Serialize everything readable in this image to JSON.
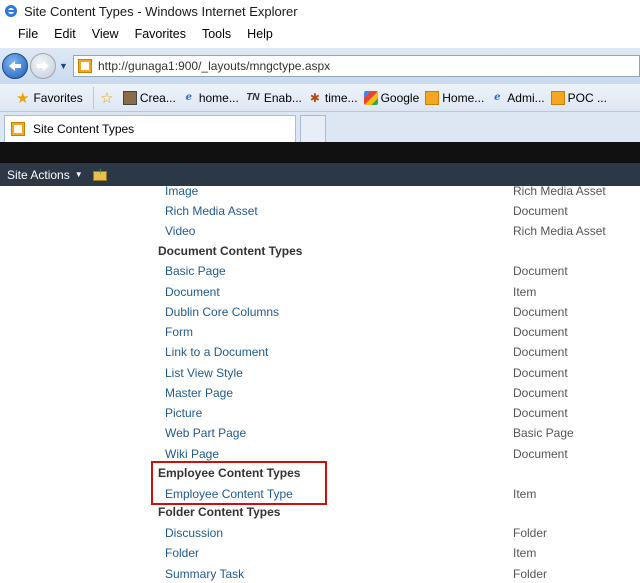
{
  "window": {
    "title": "Site Content Types - Windows Internet Explorer"
  },
  "menubar": {
    "items": [
      "File",
      "Edit",
      "View",
      "Favorites",
      "Tools",
      "Help"
    ]
  },
  "address": {
    "url": "http://gunaga1:900/_layouts/mngctype.aspx"
  },
  "favorites": {
    "label": "Favorites",
    "items": [
      {
        "label": "Crea...",
        "icon": "photo-icon"
      },
      {
        "label": "home...",
        "icon": "ie-icon"
      },
      {
        "label": "Enab...",
        "icon": "tn-icon"
      },
      {
        "label": "time...",
        "icon": "bug-icon"
      },
      {
        "label": "Google",
        "icon": "google-icon"
      },
      {
        "label": "Home...",
        "icon": "sharepoint-icon"
      },
      {
        "label": "Admi...",
        "icon": "ie-icon"
      },
      {
        "label": "POC ...",
        "icon": "sharepoint-icon"
      }
    ]
  },
  "tab": {
    "label": "Site Content Types"
  },
  "actionbar": {
    "site_actions": "Site Actions"
  },
  "content": {
    "rows": [
      {
        "kind": "item",
        "name": "Image",
        "parent": "Rich Media Asset"
      },
      {
        "kind": "item",
        "name": "Rich Media Asset",
        "parent": "Document"
      },
      {
        "kind": "item",
        "name": "Video",
        "parent": "Rich Media Asset"
      },
      {
        "kind": "group",
        "name": "Document Content Types"
      },
      {
        "kind": "item",
        "name": "Basic Page",
        "parent": "Document"
      },
      {
        "kind": "item",
        "name": "Document",
        "parent": "Item"
      },
      {
        "kind": "item",
        "name": "Dublin Core Columns",
        "parent": "Document"
      },
      {
        "kind": "item",
        "name": "Form",
        "parent": "Document"
      },
      {
        "kind": "item",
        "name": "Link to a Document",
        "parent": "Document"
      },
      {
        "kind": "item",
        "name": "List View Style",
        "parent": "Document"
      },
      {
        "kind": "item",
        "name": "Master Page",
        "parent": "Document"
      },
      {
        "kind": "item",
        "name": "Picture",
        "parent": "Document"
      },
      {
        "kind": "item",
        "name": "Web Part Page",
        "parent": "Basic Page"
      },
      {
        "kind": "item",
        "name": "Wiki Page",
        "parent": "Document"
      },
      {
        "kind": "group",
        "name": "Employee Content Types"
      },
      {
        "kind": "item",
        "name": "Employee Content Type",
        "parent": "Item"
      },
      {
        "kind": "group",
        "name": "Folder Content Types"
      },
      {
        "kind": "item",
        "name": "Discussion",
        "parent": "Folder"
      },
      {
        "kind": "item",
        "name": "Folder",
        "parent": "Item"
      },
      {
        "kind": "item",
        "name": "Summary Task",
        "parent": "Folder"
      }
    ]
  },
  "colors": {
    "link": "#1f5a8e",
    "highlight": "#cc1010",
    "actionbar": "#2c3845"
  }
}
